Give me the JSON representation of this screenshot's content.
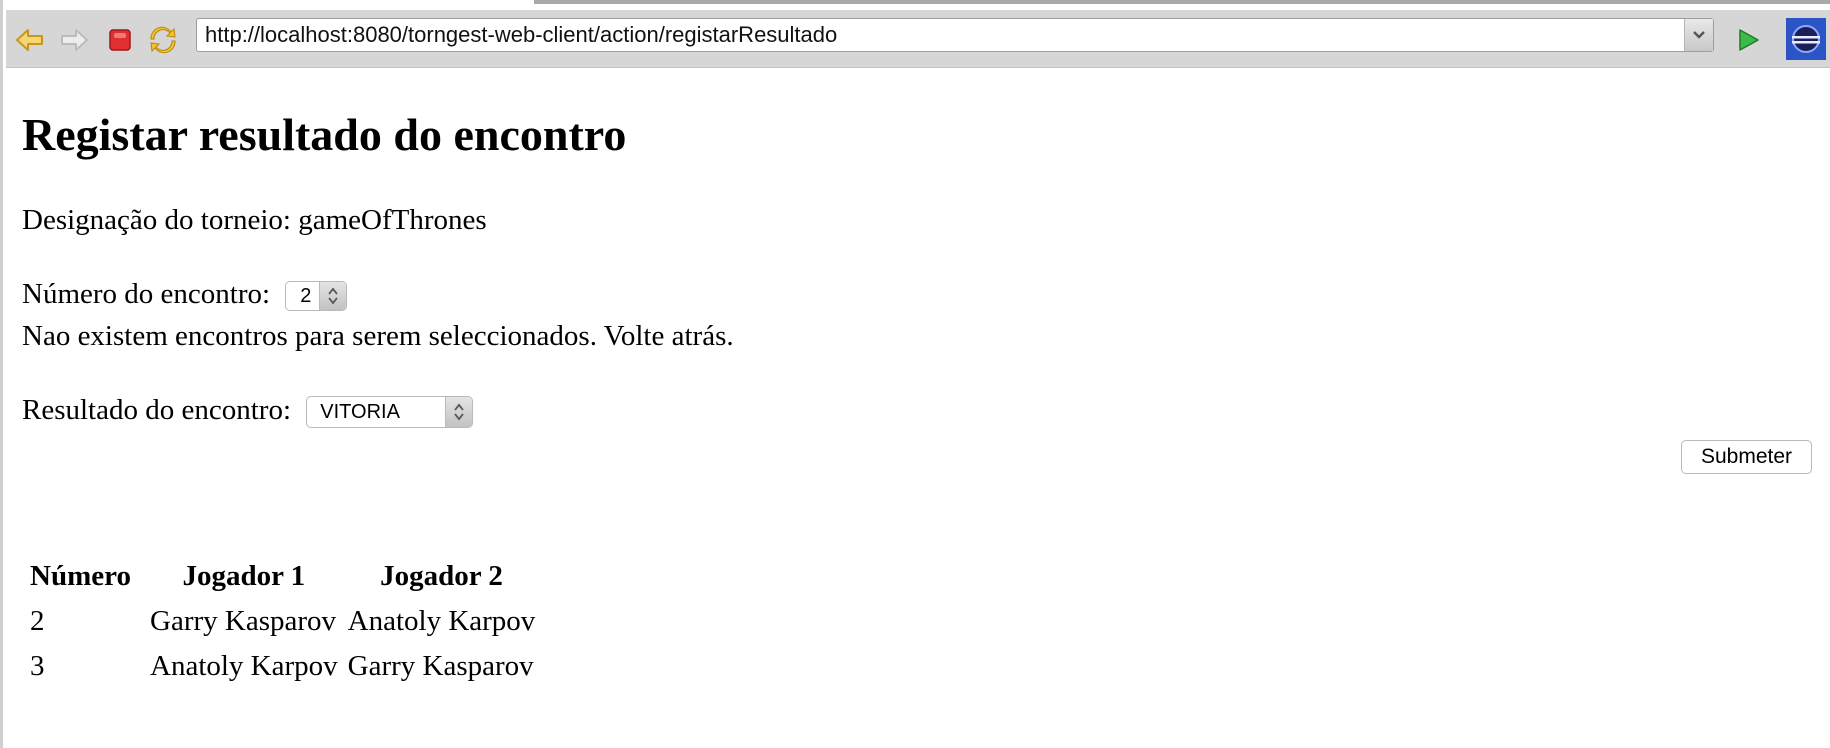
{
  "browser": {
    "url": "http://localhost:8080/torngest-web-client/action/registarResultado",
    "icons": [
      "back-arrow-icon",
      "forward-arrow-icon",
      "stop-icon",
      "refresh-icon",
      "chevron-down-icon",
      "go-icon",
      "eclipse-icon"
    ]
  },
  "page": {
    "title": "Registar resultado do encontro",
    "tournament_label": "Designação do torneio: gameOfThrones",
    "match_number_label": "Número do encontro:",
    "match_number_value": "2",
    "no_matches_message": "Nao existem encontros para serem seleccionados. Volte atrás.",
    "result_label": "Resultado do encontro:",
    "result_value": "VITORIA",
    "submit_label": "Submeter"
  },
  "table": {
    "headers": [
      "Número",
      "Jogador 1",
      "Jogador 2"
    ],
    "rows": [
      [
        "2",
        "Garry Kasparov",
        "Anatoly Karpov"
      ],
      [
        "3",
        "Anatoly Karpov",
        "Garry Kasparov"
      ]
    ]
  },
  "colors": {
    "toolbar": "#d6d6d6",
    "back_arrow": "#f2c230",
    "stop": "#e03030",
    "go": "#2fa33a"
  }
}
